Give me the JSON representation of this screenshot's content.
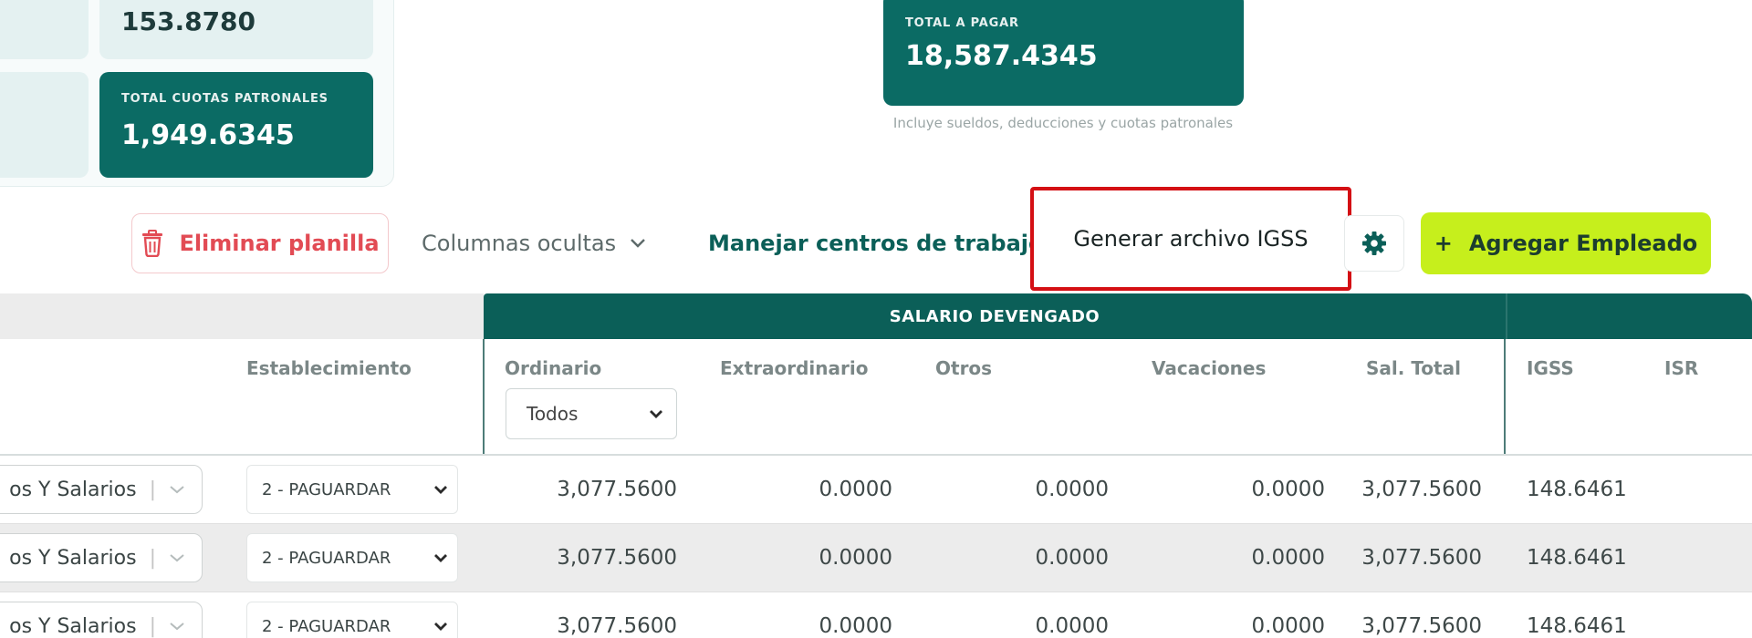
{
  "summary": {
    "tile_value_top": "153.8780",
    "patronales_label": "TOTAL CUOTAS PATRONALES",
    "patronales_value": "1,949.6345"
  },
  "total": {
    "label": "TOTAL A PAGAR",
    "value": "18,587.4345",
    "note": "Incluye sueldos, deducciones y cuotas patronales"
  },
  "toolbar": {
    "delete_label": "Eliminar planilla",
    "hidden_columns_label": "Columnas ocultas",
    "centros_label": "Manejar centros de trabajo",
    "igss_label": "Generar archivo IGSS",
    "add_label": "Agregar Empleado",
    "add_plus": "+"
  },
  "table": {
    "group_salario": "SALARIO DEVENGADO",
    "headers": {
      "establecimiento": "Establecimiento",
      "ordinario": "Ordinario",
      "extraordinario": "Extraordinario",
      "otros": "Otros",
      "vacaciones": "Vacaciones",
      "sal_total": "Sal. Total",
      "igss": "IGSS",
      "isr": "ISR"
    },
    "filter_ordinario": "Todos",
    "rows": [
      {
        "tipo": "os Y Salarios",
        "establecimiento": "2 - PAGUARDAR",
        "ordinario": "3,077.5600",
        "extraordinario": "0.0000",
        "otros": "0.0000",
        "vacaciones": "0.0000",
        "sal_total": "3,077.5600",
        "igss": "148.6461"
      },
      {
        "tipo": "os Y Salarios",
        "establecimiento": "2 - PAGUARDAR",
        "ordinario": "3,077.5600",
        "extraordinario": "0.0000",
        "otros": "0.0000",
        "vacaciones": "0.0000",
        "sal_total": "3,077.5600",
        "igss": "148.6461"
      },
      {
        "tipo": "os Y Salarios",
        "establecimiento": "2 - PAGUARDAR",
        "ordinario": "3,077.5600",
        "extraordinario": "0.0000",
        "otros": "0.0000",
        "vacaciones": "0.0000",
        "sal_total": "3,077.5600",
        "igss": "148.6461"
      }
    ]
  },
  "colors": {
    "teal": "#0b6b64",
    "danger": "#e24b54",
    "accent_lime": "#c6ef1c",
    "highlight_red": "#d40f14"
  }
}
